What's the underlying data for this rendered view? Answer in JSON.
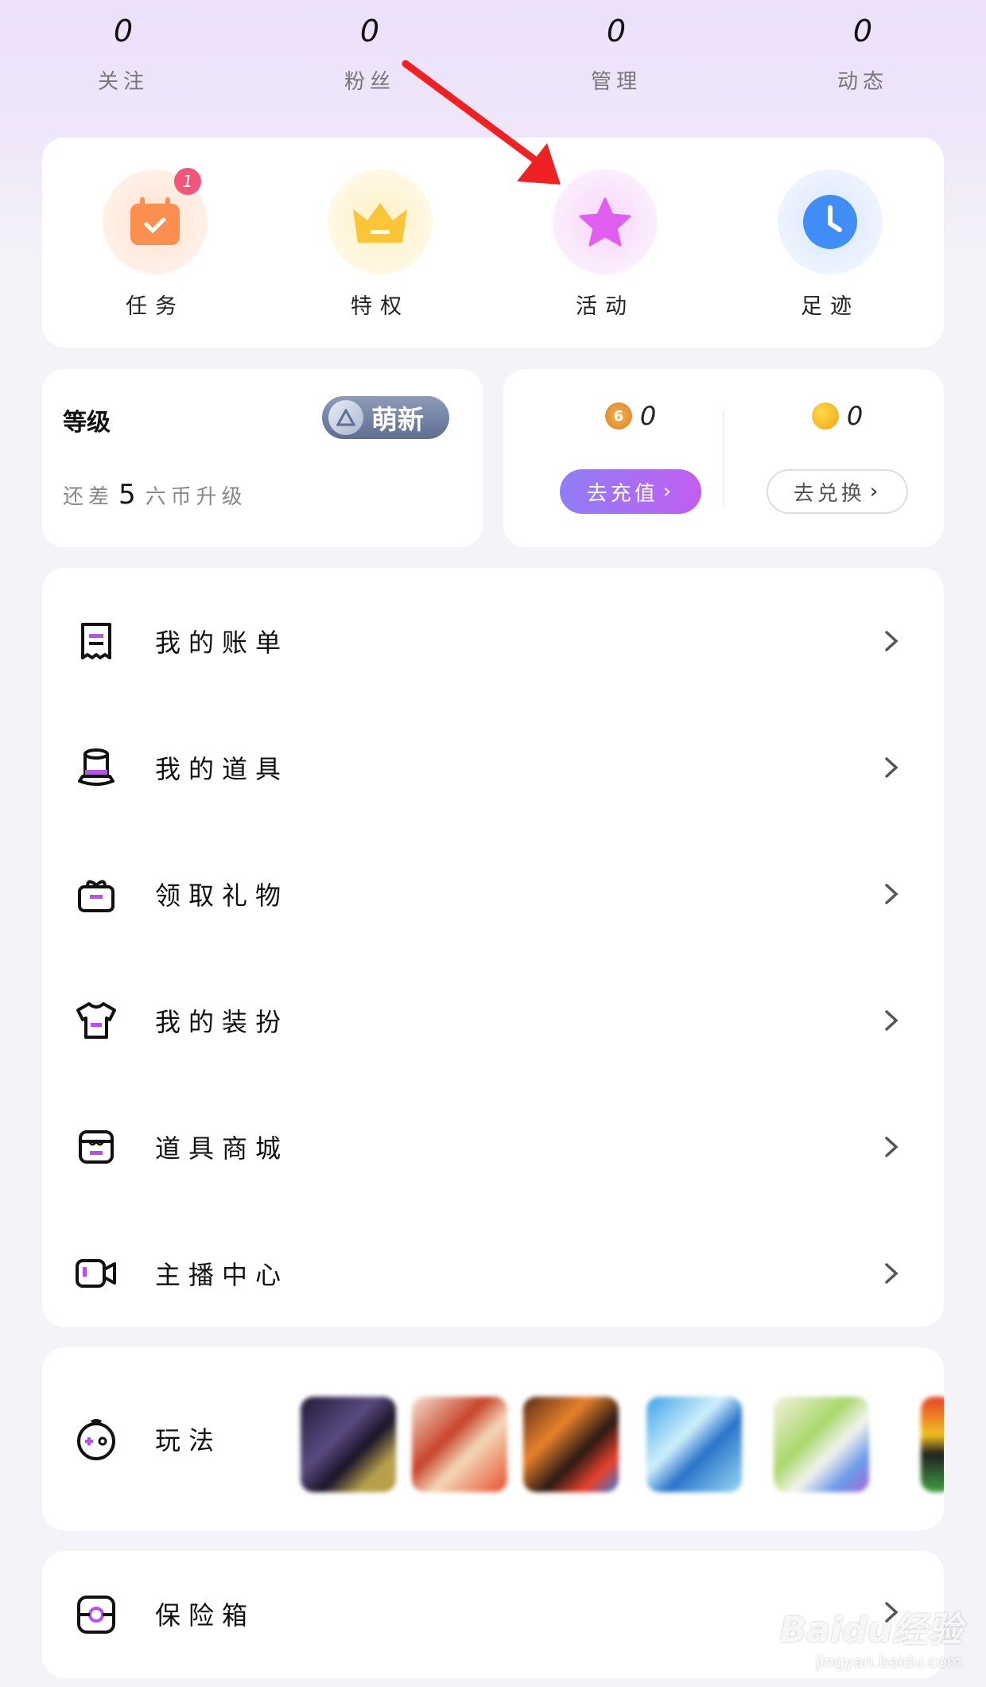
{
  "stats": [
    {
      "value": "0",
      "label": "关注"
    },
    {
      "value": "0",
      "label": "粉丝"
    },
    {
      "value": "0",
      "label": "管理"
    },
    {
      "value": "0",
      "label": "动态"
    }
  ],
  "quick": [
    {
      "label": "任务",
      "icon": "task-calendar-icon",
      "badge": "1",
      "color": "#fb8f4f"
    },
    {
      "label": "特权",
      "icon": "crown-icon",
      "color": "#fbc53a"
    },
    {
      "label": "活动",
      "icon": "star-icon",
      "color": "#e05ef0"
    },
    {
      "label": "足迹",
      "icon": "clock-icon",
      "color": "#3f8df5"
    }
  ],
  "level": {
    "title": "等级",
    "tag": "萌新",
    "hint_prefix": "还差",
    "hint_value": "5",
    "hint_suffix": "六币升级"
  },
  "wallet": {
    "coins": {
      "value": "0",
      "button": "去充值"
    },
    "beans": {
      "value": "0",
      "button": "去兑换"
    }
  },
  "menu": [
    {
      "label": "我的账单",
      "icon": "bill-icon"
    },
    {
      "label": "我的道具",
      "icon": "magic-hat-icon"
    },
    {
      "label": "领取礼物",
      "icon": "gift-icon"
    },
    {
      "label": "我的装扮",
      "icon": "shirt-icon"
    },
    {
      "label": "道具商城",
      "icon": "shop-icon"
    },
    {
      "label": "主播中心",
      "icon": "video-camera-icon"
    }
  ],
  "games": {
    "label": "玩法",
    "icon": "gamepad-icon"
  },
  "safe": {
    "label": "保险箱",
    "icon": "safe-icon"
  },
  "watermark": {
    "line1": "Baidu经验",
    "line2": "jingyan.baidu.com"
  },
  "colors": {
    "accent_start": "#8f7ef5",
    "accent_end": "#c25ef2",
    "annotation": "#ee2222"
  }
}
